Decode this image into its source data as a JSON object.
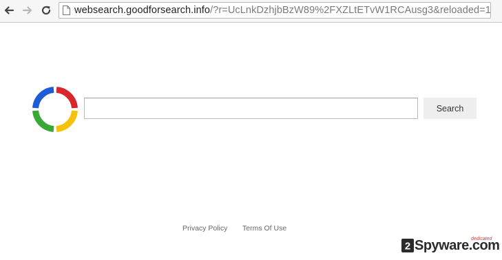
{
  "browser": {
    "url_domain": "websearch.goodforsearch.info",
    "url_path": "/?r=UcLnkDzhjbBzW89%2FXZLtETvW1RCAusg3&reloaded=1"
  },
  "icons": {
    "back": "arrow-left-icon",
    "forward": "arrow-right-icon",
    "reload": "reload-icon",
    "page": "page-icon",
    "logo": "ring-logo"
  },
  "search": {
    "value": "",
    "placeholder": "",
    "button_label": "Search"
  },
  "footer": {
    "links": [
      {
        "label": "Privacy Policy"
      },
      {
        "label": "Terms Of Use"
      }
    ]
  },
  "watermark": {
    "digit": "2",
    "text": "Spyware",
    "suffix": ".com",
    "tag": "dedicated"
  },
  "colors": {
    "logo_red": "#d8262a",
    "logo_yellow": "#f4c20d",
    "logo_green": "#3aa835",
    "logo_blue": "#1e5bd6",
    "watermark_red": "#d13b3b"
  }
}
